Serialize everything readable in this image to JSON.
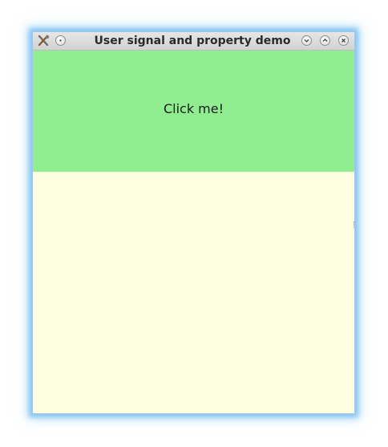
{
  "window": {
    "title": "User signal and property demo",
    "icons": {
      "app": "tools-icon",
      "menu": "window-menu-icon",
      "minimize": "chevron-down-icon",
      "maximize": "chevron-up-icon",
      "close": "close-icon"
    }
  },
  "content": {
    "click_label": "Click me!",
    "colors": {
      "click_area": "#90ee90",
      "lower_area": "#fefee1"
    }
  }
}
